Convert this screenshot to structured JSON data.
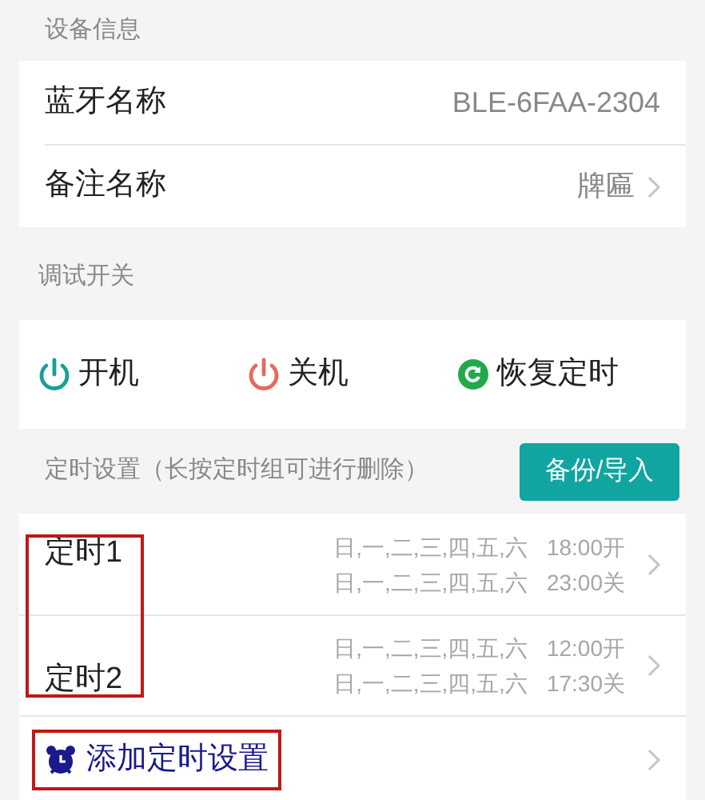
{
  "device_info": {
    "header": "设备信息",
    "rows": [
      {
        "label": "蓝牙名称",
        "value": "BLE-6FAA-2304",
        "chevron": false
      },
      {
        "label": "备注名称",
        "value": "牌匾",
        "chevron": true
      }
    ]
  },
  "debug_switch": {
    "header": "调试开关",
    "buttons": [
      {
        "kind": "power_on",
        "label": "开机"
      },
      {
        "kind": "power_off",
        "label": "关机"
      },
      {
        "kind": "restore",
        "label": "恢复定时"
      }
    ]
  },
  "timer_settings": {
    "header": "定时设置（长按定时组可进行删除）",
    "button": "备份/导入",
    "names_highlighted": true,
    "timers": [
      {
        "name": "定时1",
        "schedules": [
          {
            "days": "日,一,二,三,四,五,六",
            "time": "18:00开"
          },
          {
            "days": "日,一,二,三,四,五,六",
            "time": "23:00关"
          }
        ]
      },
      {
        "name": "定时2",
        "schedules": [
          {
            "days": "日,一,二,三,四,五,六",
            "time": "12:00开"
          },
          {
            "days": "日,一,二,三,四,五,六",
            "time": "17:30关"
          }
        ]
      }
    ],
    "add_timer": {
      "label": "添加定时设置",
      "highlighted": true
    }
  }
}
